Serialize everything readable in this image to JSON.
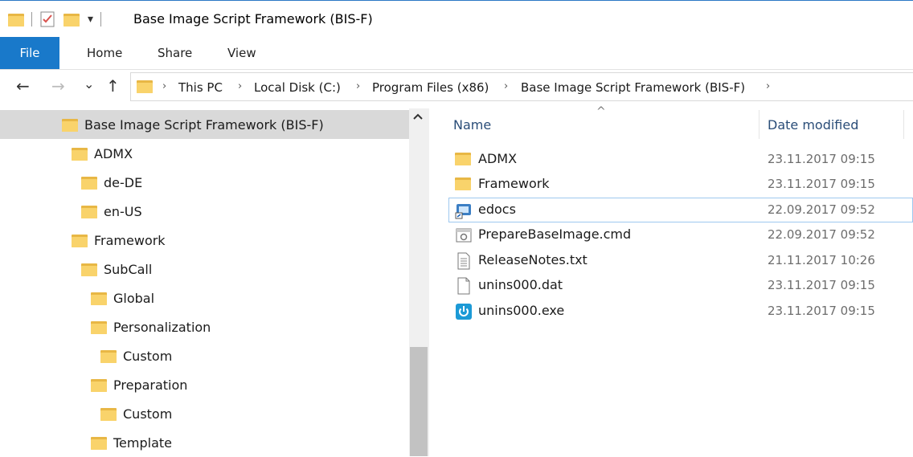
{
  "window": {
    "title": "Base Image Script Framework (BIS-F)"
  },
  "qat": {
    "dropdown_glyph": "▾"
  },
  "ribbon": {
    "tabs": [
      "File",
      "Home",
      "Share",
      "View"
    ]
  },
  "nav": {
    "back": "←",
    "forward": "→",
    "recent": "⌄",
    "up": "↑"
  },
  "address": {
    "crumbs": [
      "This PC",
      "Local Disk (C:)",
      "Program Files (x86)",
      "Base Image Script Framework (BIS-F)"
    ],
    "separator": "›"
  },
  "tree": {
    "selected": "Base Image Script Framework (BIS-F)",
    "items": [
      {
        "label": "Base Image Script Framework (BIS-F)",
        "level": 0,
        "selected": true
      },
      {
        "label": "ADMX",
        "level": 1
      },
      {
        "label": "de-DE",
        "level": 2
      },
      {
        "label": "en-US",
        "level": 2
      },
      {
        "label": "Framework",
        "level": 1
      },
      {
        "label": "SubCall",
        "level": 2
      },
      {
        "label": "Global",
        "level": 3
      },
      {
        "label": "Personalization",
        "level": 3
      },
      {
        "label": "Custom",
        "level": 4
      },
      {
        "label": "Preparation",
        "level": 3
      },
      {
        "label": "Custom",
        "level": 4
      },
      {
        "label": "Template",
        "level": 3
      }
    ]
  },
  "files": {
    "columns": {
      "name": "Name",
      "date": "Date modified"
    },
    "sort_glyph": "^",
    "rows": [
      {
        "name": "ADMX",
        "date": "23.11.2017 09:15",
        "icon": "folder-icon"
      },
      {
        "name": "Framework",
        "date": "23.11.2017 09:15",
        "icon": "folder-icon"
      },
      {
        "name": "edocs",
        "date": "22.09.2017 09:52",
        "icon": "shortcut-icon"
      },
      {
        "name": "PrepareBaseImage.cmd",
        "date": "22.09.2017 09:52",
        "icon": "script-icon"
      },
      {
        "name": "ReleaseNotes.txt",
        "date": "21.11.2017 10:26",
        "icon": "text-file-icon"
      },
      {
        "name": "unins000.dat",
        "date": "23.11.2017 09:15",
        "icon": "blank-file-icon"
      },
      {
        "name": "unins000.exe",
        "date": "23.11.2017 09:15",
        "icon": "uninstaller-icon"
      }
    ]
  },
  "colors": {
    "accent": "#1979ca",
    "folder": "#f9d36b",
    "selection": "#d9d9d9"
  }
}
